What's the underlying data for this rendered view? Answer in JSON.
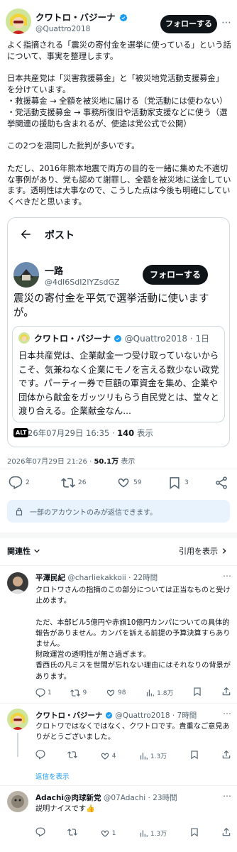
{
  "main_post": {
    "author_name": "クワトロ・バジーナ",
    "author_handle": "@Quattro2018",
    "follow_label": "フォローする",
    "text": "よく指摘される「震災の寄付金を選挙に使っている」という話について、事実を整理します。\n\n日本共産党は「災害救援募金」と「被災地党活動支援募金」を分けています。\n・救援募金 → 全額を被災地に届ける（党活動には使わない）\n・党活動支援募金 → 事務所復旧や活動家支援などに使う（選挙関連の援助も含まれるが、使途は党公式で公開）\n\nこの2つを混同した批判が多いです。\n\nただし、2016年熊本地震で両方の目的を一緒に集めた不適切な事例があり、党も認めて謝罪し、全額を被災地に送金しています。透明性は大事なので、こうした点は今後も明確にしていくべきだと思います。",
    "timestamp": "2026年07月29日 21:26",
    "views_count": "50.1万",
    "views_label": "表示",
    "stats": {
      "replies": "2",
      "reposts": "26",
      "likes": "59",
      "bookmarks": "3"
    },
    "reply_restriction": "一部のアカウントのみが返信できます。"
  },
  "embedded_screenshot": {
    "header_title": "ポスト",
    "author_name": "一路",
    "author_handle": "@4dI6SdI2lYZsdGZ",
    "follow_label": "フォローする",
    "text": "震災の寄付金を平気で選挙活動に使いますが。",
    "quote": {
      "author_name": "クワトロ・バジーナ",
      "author_handle": "@Quattro2018",
      "age": "1日",
      "text": "日本共産党は、企業献金一つ受け取っていないからこそ、気兼ねなく企業にモノを言える数少ない政党です。パーティー券で巨額の軍資金を集め、企業や団体から献金をガッツリもらう自民党とは、堂々と渡り合える。企業献金なん..."
    },
    "alt_badge": "ALT",
    "timestamp": "26年07月29日 16:35",
    "views_count": "140",
    "views_label": "表示"
  },
  "sort_bar": {
    "relevance_label": "関連性",
    "quotes_label": "引用を表示"
  },
  "replies": [
    {
      "author_name": "平澤民紀",
      "author_handle": "@charliekakkoii",
      "age": "22時間",
      "text": "クロトワさんの指摘のこの部分については正当なものと受け止めます。\n\nただ、本部ビル5億円や赤旗10億円カンパについての具体的報告がありません。カンパを訴える前提の予算決算すらありません。\n財政運営の透明性が無さ過ぎます。\n香西氏の凡ミスを世間が忘れない理由にはそれなりの背景があります。",
      "stats": {
        "replies": "1",
        "reposts": "9",
        "likes": "98",
        "views": "1.8万"
      }
    },
    {
      "author_name": "クワトロ・バジーナ",
      "author_handle": "@Quattro2018",
      "age": "7時間",
      "text": "クロトワではなくではなく、クワトロです。貴重なご意見ありがとうございました。",
      "stats": {
        "replies": "",
        "reposts": "",
        "likes": "4",
        "views": "1.3万"
      },
      "show_replies_label": "返信を表示"
    },
    {
      "author_name": "Adachi@肉球新党",
      "author_handle": "@07Adachi",
      "age": "23時間",
      "text": "説明ナイスです👍",
      "stats": {
        "replies": "",
        "reposts": "",
        "likes": "1",
        "views": "1.3万"
      }
    }
  ],
  "colors": {
    "accent": "#1d9bf0",
    "text": "#0f1419",
    "muted": "#536471",
    "border": "#eff3f4"
  },
  "icons": [
    "verified-icon",
    "back-arrow-icon",
    "reply-icon",
    "repost-icon",
    "like-icon",
    "bookmark-icon",
    "share-icon",
    "views-icon",
    "info-icon",
    "chevron-down-icon",
    "chevron-right-icon"
  ]
}
